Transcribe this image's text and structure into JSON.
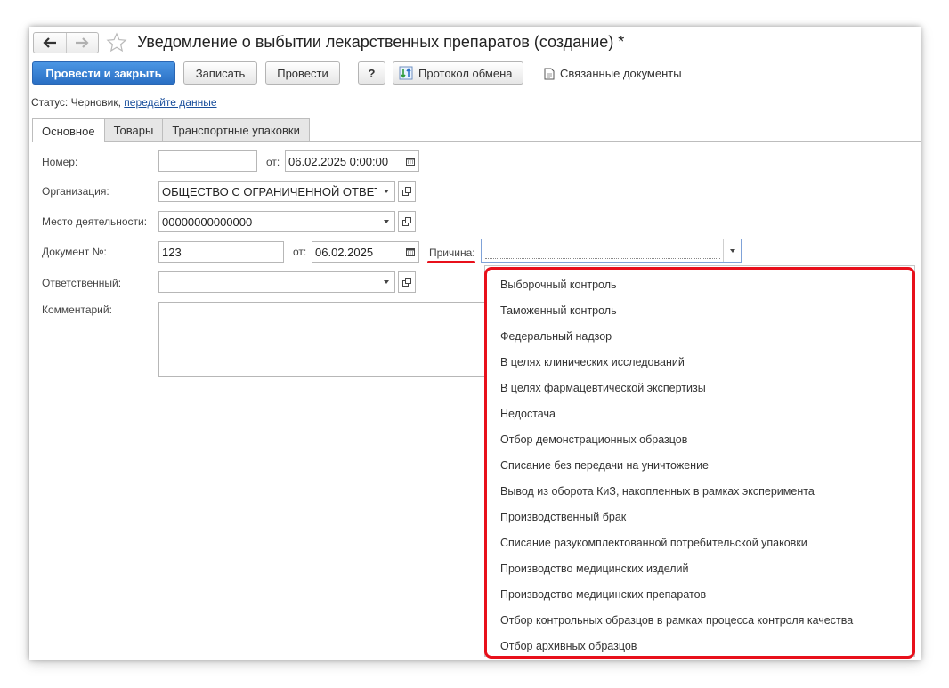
{
  "window": {
    "title": "Уведомление о выбытии лекарственных препаратов (создание) *"
  },
  "toolbar": {
    "post_close": "Провести и закрыть",
    "write": "Записать",
    "post": "Провести",
    "help": "?",
    "exchange_log": "Протокол обмена",
    "related_docs": "Связанные документы"
  },
  "status": {
    "label": "Статус:",
    "value": "Черновик,",
    "link": "передайте данные"
  },
  "tabs": [
    {
      "label": "Основное",
      "active": true
    },
    {
      "label": "Товары",
      "active": false
    },
    {
      "label": "Транспортные упаковки",
      "active": false
    }
  ],
  "form": {
    "number_label": "Номер:",
    "number_value": "",
    "from_label": "от:",
    "number_date": "06.02.2025  0:00:00",
    "org_label": "Организация:",
    "org_value": "ОБЩЕСТВО С ОГРАНИЧЕННОЙ ОТВЕТСТВЕННОСТЬЮ",
    "place_label": "Место деятельности:",
    "place_value": "00000000000000",
    "doc_label": "Документ №:",
    "doc_value": "123",
    "doc_from_label": "от:",
    "doc_date": "06.02.2025",
    "reason_label": "Причина:",
    "reason_value": "",
    "responsible_label": "Ответственный:",
    "responsible_value": "",
    "comment_label": "Комментарий:"
  },
  "reason_options": [
    "Выборочный контроль",
    "Таможенный контроль",
    "Федеральный надзор",
    "В целях клинических исследований",
    "В целях фармацевтической экспертизы",
    "Недостача",
    "Отбор демонстрационных образцов",
    "Списание без передачи на уничтожение",
    "Вывод из оборота КиЗ, накопленных в рамках эксперимента",
    "Производственный брак",
    "Списание разукомплектованной потребительской упаковки",
    "Производство медицинских изделий",
    "Производство медицинских препаратов",
    "Отбор контрольных образцов в рамках процесса контроля качества",
    "Отбор архивных образцов"
  ],
  "colors": {
    "primary": "#2a6fc4",
    "highlight": "#e8101b",
    "link": "#1a4f9c"
  }
}
